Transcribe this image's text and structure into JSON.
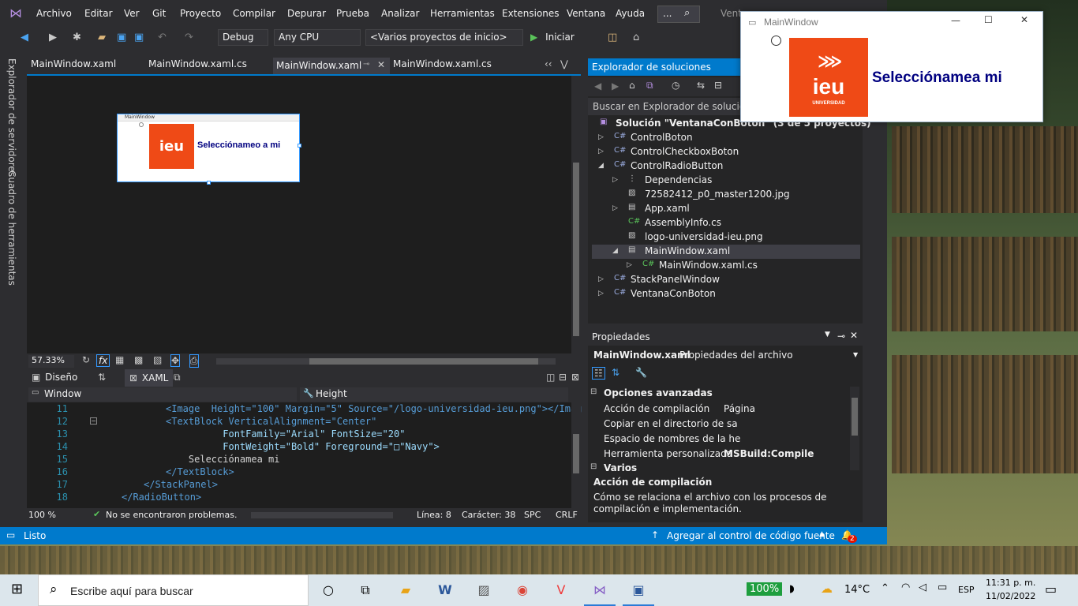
{
  "menu": {
    "items": [
      "Archivo",
      "Editar",
      "Ver",
      "Git",
      "Proyecto",
      "Compilar",
      "Depurar",
      "Prueba",
      "Analizar",
      "Herramientas",
      "Extensiones",
      "Ventana",
      "Ayuda"
    ],
    "search_label": "...",
    "title_partial": "Vent"
  },
  "toolbar": {
    "config": "Debug",
    "platform": "Any CPU",
    "startup": "<Varios proyectos de inicio>",
    "start_label": "Iniciar"
  },
  "side_tabs": [
    "Explorador de servidores",
    "Cuadro de herramientas"
  ],
  "doc_tabs": [
    "MainWindow.xaml",
    "MainWindow.xaml.cs",
    "MainWindow.xaml",
    "MainWindow.xaml.cs"
  ],
  "designer": {
    "preview_title": "MainWindow",
    "preview_text": "Selecciónameo a mi",
    "zoom": "57.33%",
    "fx": "fx",
    "view_design": "Diseño",
    "view_xaml": "XAML",
    "element_combo": "Window",
    "property_combo": "Height"
  },
  "code": [
    {
      "n": "11",
      "t": "<Image  Height=\"100\" Margin=\"5\" Source=\"/logo-universidad-ieu.png\"></Imag"
    },
    {
      "n": "12",
      "t": "<TextBlock VerticalAlignment=\"Center\""
    },
    {
      "n": "13",
      "t": "          FontFamily=\"Arial\" FontSize=\"20\""
    },
    {
      "n": "14",
      "t": "          FontWeight=\"Bold\" Foreground=\"□\"Navy\">"
    },
    {
      "n": "15",
      "t": "    Selecciónamea mi"
    },
    {
      "n": "16",
      "t": "</TextBlock>"
    },
    {
      "n": "17",
      "t": "</StackPanel>"
    },
    {
      "n": "18",
      "t": "</RadioButton>"
    }
  ],
  "editor_status": {
    "zoom": "100 %",
    "problems": "No se encontraron problemas.",
    "line": "Línea: 8",
    "char": "Carácter: 38",
    "spc": "SPC",
    "crlf": "CRLF"
  },
  "solution_explorer": {
    "title": "Explorador de soluciones",
    "search_placeholder": "Buscar en Explorador de soluciones",
    "solution": "Solución \"VentanaConBoton\" (3 de 5 proyectos)",
    "items": [
      "ControlBoton",
      "ControlCheckboxBoton",
      "ControlRadioButton",
      "Dependencias",
      "72582412_p0_master1200.jpg",
      "App.xaml",
      "AssemblyInfo.cs",
      "logo-universidad-ieu.png",
      "MainWindow.xaml",
      "MainWindow.xaml.cs",
      "StackPanelWindow",
      "VentanaConBoton"
    ]
  },
  "properties": {
    "title": "Propiedades",
    "file": "MainWindow.xaml",
    "file_type": "Propiedades del archivo",
    "section_advanced": "Opciones avanzadas",
    "rows": [
      {
        "k": "Acción de compilación",
        "v": "Página"
      },
      {
        "k": "Copiar en el directorio de sa",
        "v": ""
      },
      {
        "k": "Espacio de nombres de la he",
        "v": ""
      },
      {
        "k": "Herramienta personalizada",
        "v": "MSBuild:Compile"
      }
    ],
    "section_misc": "Varios",
    "desc_title": "Acción de compilación",
    "desc_text": "Cómo se relaciona el archivo con los procesos de compilación e implementación."
  },
  "statusbar": {
    "ready": "Listo",
    "source_control": "Agregar al control de código fuente",
    "notif_count": "2"
  },
  "running_window": {
    "title": "MainWindow",
    "text": "Selecciónamea mi",
    "logo_text": "ieu",
    "logo_sub": "UNIVERSIDAD"
  },
  "taskbar": {
    "search_placeholder": "Escribe aquí para buscar",
    "battery": "100%",
    "weather": "14°C",
    "lang": "ESP",
    "time": "11:31 p. m.",
    "date": "11/02/2022"
  },
  "colors": {
    "vs_bg": "#2d2d30",
    "editor_bg": "#1e1e1e",
    "accent": "#007acc",
    "ieu_orange": "#ef4a16",
    "navy": "#000080"
  }
}
